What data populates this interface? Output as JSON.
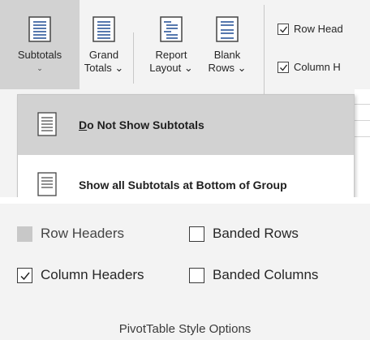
{
  "ribbon": {
    "buttons": [
      {
        "line1": "Subtotals",
        "line2": "⌄",
        "icon": "subtotals-icon"
      },
      {
        "line1": "Grand",
        "line2": "Totals ⌄",
        "icon": "grand-totals-icon"
      },
      {
        "line1": "Report",
        "line2": "Layout ⌄",
        "icon": "report-layout-icon"
      },
      {
        "line1": "Blank",
        "line2": "Rows ⌄",
        "icon": "blank-rows-icon"
      }
    ],
    "checks": [
      {
        "label": "Row Head",
        "checked": true
      },
      {
        "label": "Column H",
        "checked": true
      }
    ]
  },
  "subtotals_menu": {
    "items": [
      {
        "accel": "D",
        "rest": "o Not Show Subtotals",
        "highlighted": true,
        "icon": "no-subtotals-icon"
      },
      {
        "label": "Show all Subtotals at Bottom of Group",
        "highlighted": false,
        "icon": "subtotals-bottom-icon"
      }
    ]
  },
  "style_options": {
    "row_headers": {
      "label": "Row Headers",
      "checked": false,
      "disabled": true
    },
    "banded_rows": {
      "label": "Banded Rows",
      "checked": false
    },
    "column_headers": {
      "label": "Column Headers",
      "checked": true
    },
    "banded_columns": {
      "label": "Banded Columns",
      "checked": false
    },
    "group_label": "PivotTable Style Options"
  },
  "colors": {
    "ribbon_bg": "#f3f3f3",
    "pressed": "#d2d2d2",
    "icon_blue": "#2b579a"
  }
}
